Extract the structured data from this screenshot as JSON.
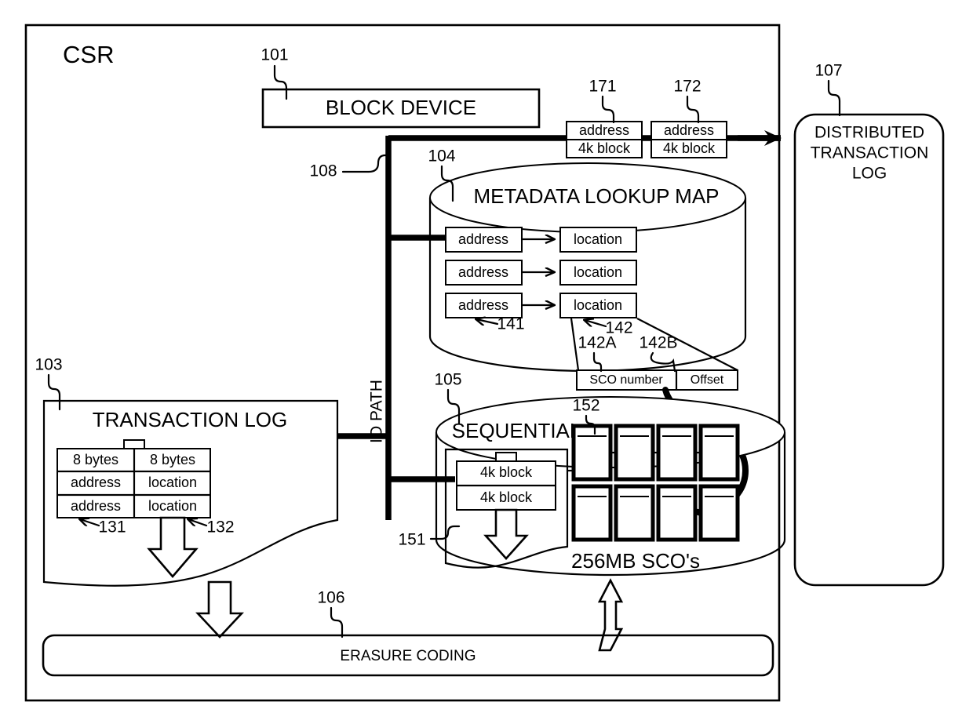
{
  "diagram": {
    "title_label": "CSR",
    "outer_boundary_name": "csr-boundary"
  },
  "blocks": {
    "block_device": {
      "label": "BLOCK DEVICE",
      "ref": "101"
    },
    "io_path": {
      "label": "IO PATH",
      "ref": "108"
    },
    "metadata_map": {
      "label": "METADATA LOOKUP MAP",
      "ref": "104"
    },
    "transaction_log": {
      "label": "TRANSACTION LOG",
      "ref": "103"
    },
    "sequential": {
      "label": "SEQUENTIAL",
      "ref": "105"
    },
    "sco_group": {
      "label": "256MB SCO's",
      "ref": "152"
    },
    "sco_container_ref": "151",
    "erasure_coding": {
      "label": "ERASURE CODING",
      "ref": "106"
    },
    "distributed_log": {
      "line1": "DISTRIBUTED",
      "line2": "TRANSACTION",
      "line3": "LOG",
      "ref": "107"
    }
  },
  "write_packets": [
    {
      "ref": "171",
      "top": "address",
      "bottom": "4k block"
    },
    {
      "ref": "172",
      "top": "address",
      "bottom": "4k block"
    }
  ],
  "metadata_rows": [
    {
      "key": "address",
      "value": "location"
    },
    {
      "key": "address",
      "value": "location"
    },
    {
      "key": "address",
      "value": "location"
    }
  ],
  "metadata_refs": {
    "key_ref": "141",
    "value_ref": "142"
  },
  "location_detail": {
    "field_a": {
      "label": "SCO number",
      "ref": "142A"
    },
    "field_b": {
      "label": "Offset",
      "ref": "142B"
    }
  },
  "transaction_log_table": {
    "header": [
      "8 bytes",
      "8 bytes"
    ],
    "rows": [
      [
        "address",
        "location"
      ],
      [
        "address",
        "location"
      ]
    ],
    "col_refs": {
      "left": "131",
      "right": "132"
    }
  },
  "sequential_blocks": {
    "rows": [
      "4k block",
      "4k block"
    ]
  }
}
